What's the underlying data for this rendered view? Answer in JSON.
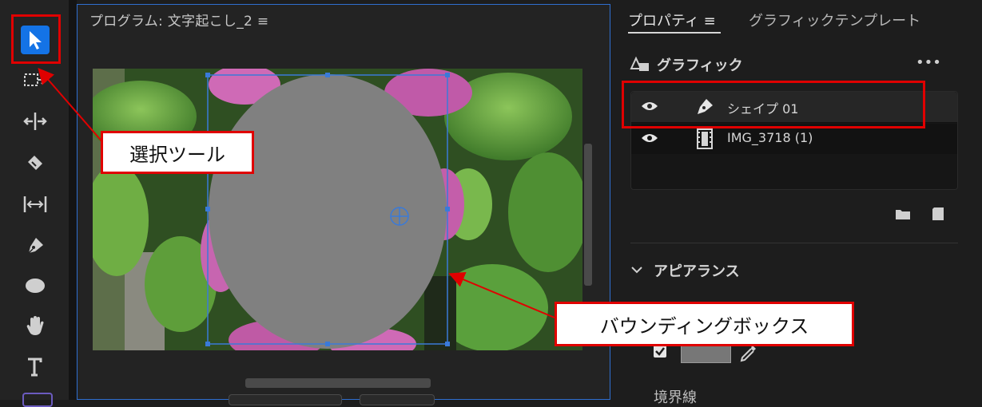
{
  "program_panel": {
    "title": "プログラム: 文字起こし_2 ≡"
  },
  "properties_panel": {
    "tabs": [
      {
        "label": "プロパティ ≡",
        "active": true
      },
      {
        "label": "グラフィックテンプレート",
        "active": false
      }
    ],
    "graphic_section": {
      "title": "グラフィック",
      "more_label": "•••"
    },
    "layers": [
      {
        "label": "シェイプ 01",
        "icon": "pen-icon",
        "visible": true,
        "selected": true
      },
      {
        "label": "IMG_3718 (1)",
        "icon": "film-icon",
        "visible": true,
        "selected": false
      }
    ],
    "appearance_section": {
      "title": "アピアランス",
      "fill_color": "#777777",
      "fill_enabled": true
    },
    "stroke_section": {
      "title": "境界線"
    }
  },
  "toolbar": {
    "tools": [
      {
        "name": "selection-tool",
        "icon": "arrow-icon",
        "active": true
      },
      {
        "name": "track-select-tool",
        "icon": "track-select-icon"
      },
      {
        "name": "ripple-edit-tool",
        "icon": "ripple-edit-icon"
      },
      {
        "name": "razor-tool",
        "icon": "razor-icon"
      },
      {
        "name": "slip-tool",
        "icon": "slip-icon"
      },
      {
        "name": "pen-tool",
        "icon": "pen-icon"
      },
      {
        "name": "ellipse-tool",
        "icon": "ellipse-icon"
      },
      {
        "name": "hand-tool",
        "icon": "hand-icon"
      },
      {
        "name": "type-tool",
        "icon": "type-icon"
      }
    ]
  },
  "annotations": {
    "selection_tool_callout": "選択ツール",
    "bounding_box_callout": "バウンディングボックス"
  },
  "colors": {
    "accent": "#2f6fd0",
    "annotation_red": "#e00000",
    "shape_gray": "#808080"
  }
}
